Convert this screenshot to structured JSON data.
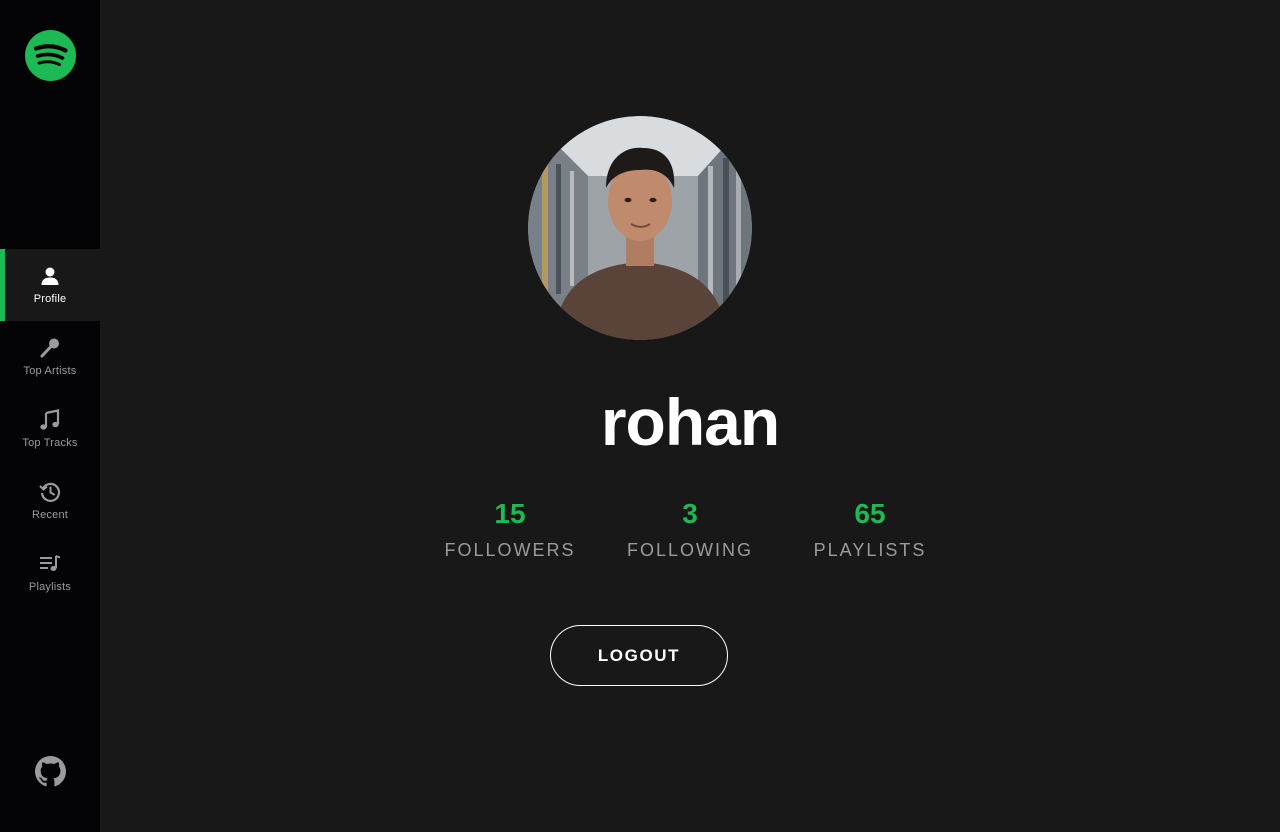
{
  "sidebar": {
    "logo_icon": "spotify-logo-icon",
    "nav_items": [
      {
        "label": "Profile",
        "icon": "user-icon",
        "active": true
      },
      {
        "label": "Top Artists",
        "icon": "microphone-icon",
        "active": false
      },
      {
        "label": "Top Tracks",
        "icon": "music-note-icon",
        "active": false
      },
      {
        "label": "Recent",
        "icon": "history-icon",
        "active": false
      },
      {
        "label": "Playlists",
        "icon": "playlist-icon",
        "active": false
      }
    ],
    "github_icon": "github-icon"
  },
  "profile": {
    "avatar_icon": "profile-photo",
    "username": "rohan",
    "stats": [
      {
        "value": "15",
        "label": "FOLLOWERS"
      },
      {
        "value": "3",
        "label": "FOLLOWING"
      },
      {
        "value": "65",
        "label": "PLAYLISTS"
      }
    ],
    "logout_label": "LOGOUT"
  },
  "colors": {
    "accent": "#1db954",
    "background": "#181818",
    "sidebar": "#040306",
    "muted_text": "#9b9b9b",
    "text": "#ffffff"
  }
}
